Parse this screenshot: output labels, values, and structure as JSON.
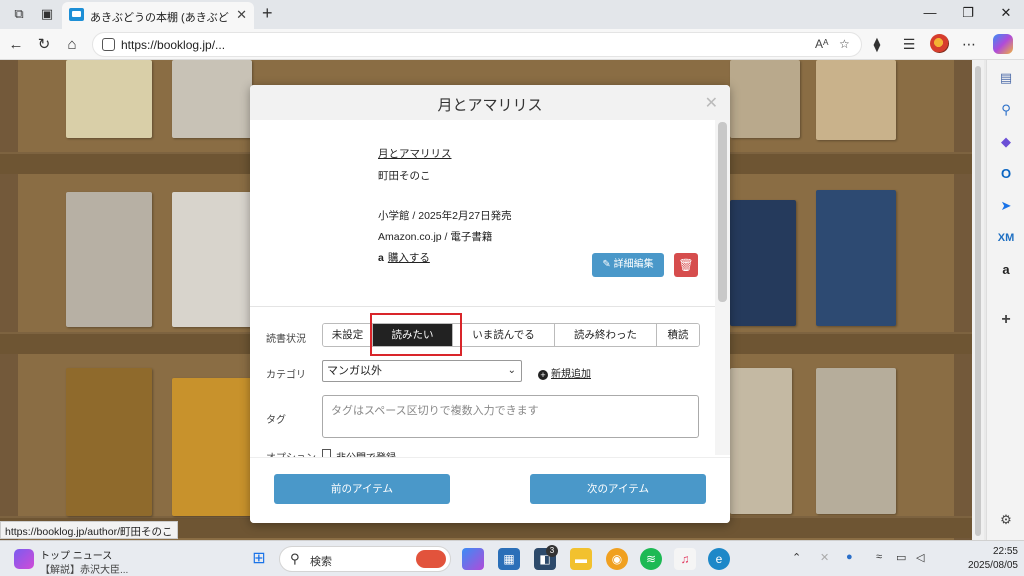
{
  "browser": {
    "tab_title": "あきぶどうの本棚 (あきぶどう) - ブクログ",
    "url": "https://booklog.jp/..."
  },
  "modal": {
    "title": "月とアマリリス",
    "book_title": "月とアマリリス",
    "author": "町田そのこ",
    "publisher_date": "小学館 / 2025年2月27日発売",
    "store_format": "Amazon.co.jp / 電子書籍",
    "buy_label": "購入する",
    "edit_label": "詳細編集",
    "reading_status_label": "読書状況",
    "status_options": [
      "未設定",
      "読みたい",
      "いま読んでる",
      "読み終わった",
      "積読"
    ],
    "status_selected": "読みたい",
    "category_label": "カテゴリ",
    "category_value": "マンガ以外",
    "new_add_label": "新規追加",
    "tag_label": "タグ",
    "tag_placeholder": "タグはスペース区切りで複数入力できます",
    "option_label": "オプション",
    "option_private": "非公開で登録",
    "prev_label": "前のアイテム",
    "next_label": "次のアイテム"
  },
  "status_link": "https://booklog.jp/author/町田そのこ",
  "taskbar": {
    "news_title": "トップ ニュース",
    "news_sub": "【解説】赤沢大臣...",
    "search_placeholder": "検索",
    "badge_count": "3",
    "time": "22:55",
    "date": "2025/08/05"
  },
  "colors": {
    "accent_button": "#4a98c9",
    "delete_button": "#d64d4d",
    "highlight": "#d9252a"
  }
}
